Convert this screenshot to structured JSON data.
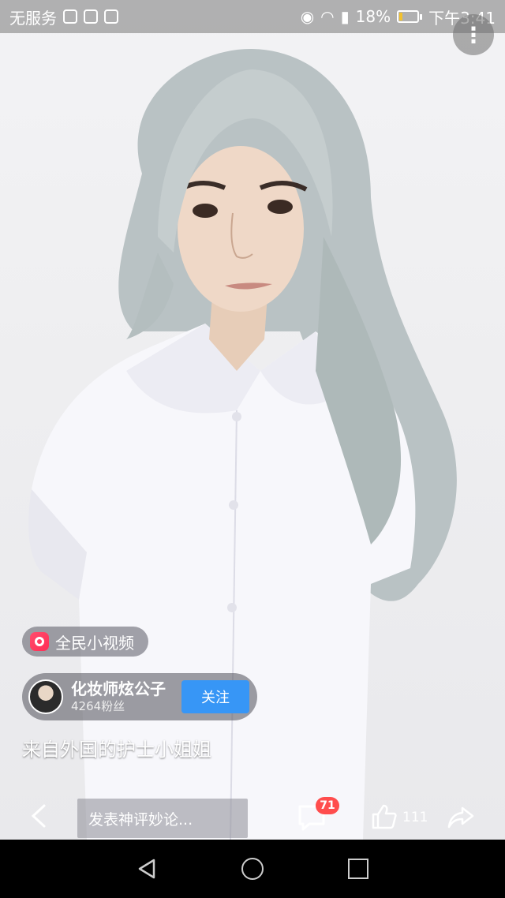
{
  "status_bar": {
    "carrier": "无服务",
    "battery_percent": "18%",
    "time": "下午3:41",
    "icons": [
      "app-icon-1",
      "baidu-icon",
      "paw-icon",
      "eye-icon",
      "wifi-icon",
      "sim-icon",
      "battery-icon"
    ]
  },
  "video": {
    "more_icon": "⋮"
  },
  "source": {
    "label": "全民小视频"
  },
  "author": {
    "name": "化妆师炫公子",
    "fans": "4264粉丝",
    "follow_label": "关注"
  },
  "caption": "来自外国的护士小姐姐",
  "action_bar": {
    "comment_placeholder": "发表神评妙论...",
    "comment_count": "71",
    "like_count": "111"
  },
  "colors": {
    "follow_button": "#3796f6",
    "badge": "#ff4d4d",
    "source_logo": "#ff2d55"
  }
}
